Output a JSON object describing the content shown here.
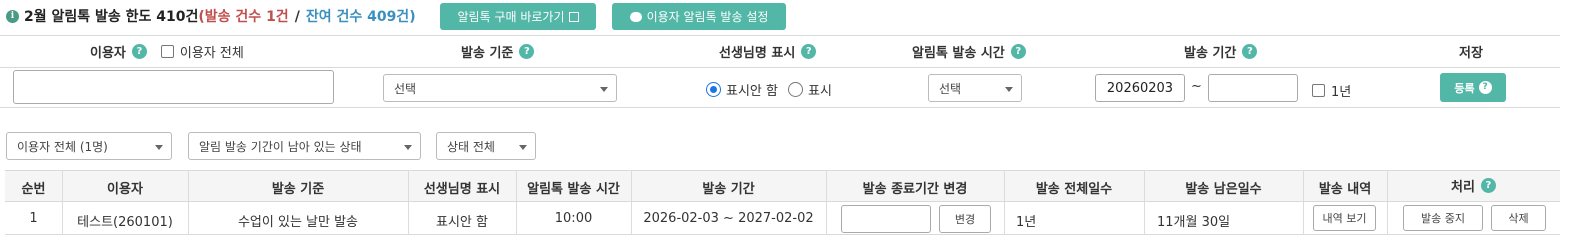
{
  "header": {
    "title_main": "2월 알림톡 발송 한도 410건",
    "paren_open": "(",
    "sent_label": "발송 건수 1건",
    "separator": "/",
    "remaining_label": "잔여 건수 409건",
    "paren_close": ")",
    "buy_button": "알림톡 구매 바로가기",
    "settings_button": "이용자 알림톡 발송 설정"
  },
  "filter": {
    "headers": {
      "user": "이용자",
      "user_all": "이용자 전체",
      "criteria": "발송 기준",
      "teacher_name": "선생님명 표시",
      "send_time": "알림톡 발송 시간",
      "period": "발송 기간",
      "save": "저장"
    },
    "user_input_value": "",
    "criteria_select": "선택",
    "radio_hide": "표시안 함",
    "radio_show": "표시",
    "radio_selected": "hide",
    "time_select": "선택",
    "period_start": "20260203",
    "period_tilde": "~",
    "period_end": "",
    "one_year": "1년",
    "register_button": "등록"
  },
  "list_filters": {
    "user_filter": "이용자 전체 (1명)",
    "period_filter": "알림 발송 기간이 남아 있는 상태",
    "status_filter": "상태 전체"
  },
  "table": {
    "columns": [
      "순번",
      "이용자",
      "발송 기준",
      "선생님명 표시",
      "알림톡 발송 시간",
      "발송 기간",
      "발송 종료기간 변경",
      "발송 전체일수",
      "발송 남은일수",
      "발송 내역",
      "처리"
    ],
    "rows": [
      {
        "no": "1",
        "user": "테스트(260101)",
        "criteria": "수업이 있는 날만 발송",
        "teacher_display": "표시안 함",
        "send_time": "10:00",
        "period": "2026-02-03 ~ 2027-02-02",
        "change_button": "변경",
        "total_days": "1년",
        "remaining_days": "11개월 30일",
        "history_button": "내역 보기",
        "stop_button": "발송 중지",
        "delete_button": "삭제"
      }
    ]
  },
  "colors": {
    "accent": "#52b7a6",
    "sent_red": "#c0504d",
    "remaining_blue": "#3b8fbf"
  },
  "icons": {
    "info": "info-circle-icon",
    "help": "question-circle-icon",
    "external": "external-link-icon",
    "chat": "chat-bubble-icon",
    "dropdown": "chevron-down-icon"
  }
}
